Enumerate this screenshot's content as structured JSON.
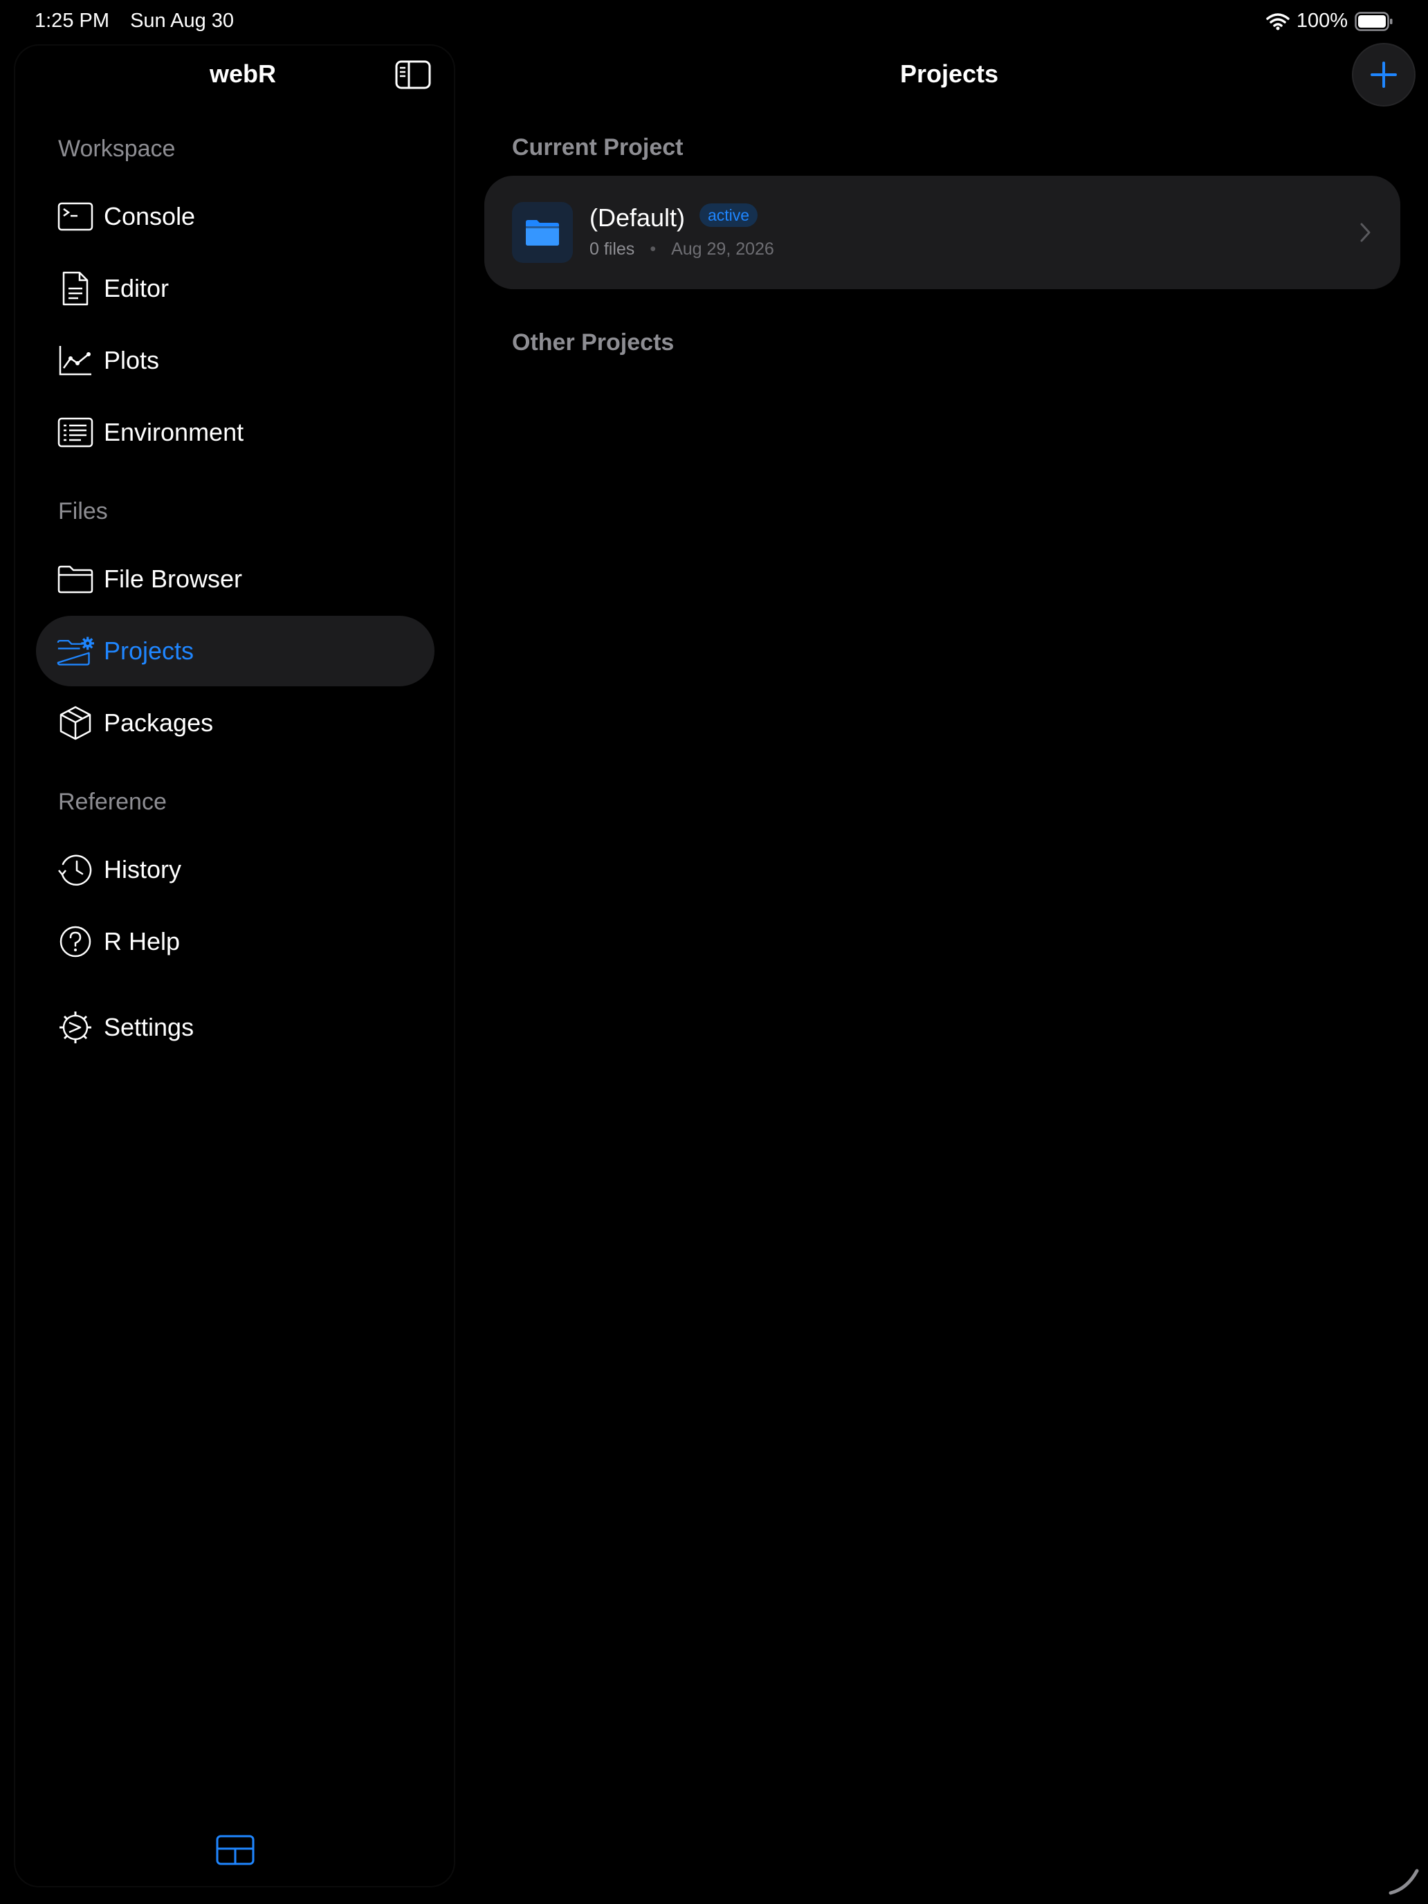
{
  "status": {
    "time": "1:25 PM",
    "date": "Sun Aug 30",
    "battery": "100%"
  },
  "sidebar": {
    "title": "webR",
    "sections": [
      {
        "label": "Workspace",
        "items": [
          {
            "label": "Console",
            "icon": "terminal-icon"
          },
          {
            "label": "Editor",
            "icon": "document-icon"
          },
          {
            "label": "Plots",
            "icon": "line-chart-icon"
          },
          {
            "label": "Environment",
            "icon": "list-icon"
          }
        ]
      },
      {
        "label": "Files",
        "items": [
          {
            "label": "File Browser",
            "icon": "folder-icon"
          },
          {
            "label": "Projects",
            "icon": "folder-gear-icon",
            "active": true
          },
          {
            "label": "Packages",
            "icon": "box-icon"
          }
        ]
      },
      {
        "label": "Reference",
        "items": [
          {
            "label": "History",
            "icon": "history-icon"
          },
          {
            "label": "R Help",
            "icon": "question-icon"
          }
        ]
      }
    ],
    "settings_label": "Settings"
  },
  "main": {
    "title": "Projects",
    "current_project_label": "Current Project",
    "other_projects_label": "Other Projects",
    "current_project": {
      "name": "(Default)",
      "badge": "active",
      "files": "0 files",
      "separator": "•",
      "date": "Aug 29, 2026"
    }
  },
  "colors": {
    "accent": "#1f86ff",
    "background": "#000000",
    "card": "#1c1c1e",
    "secondary_text": "#8e8e93"
  }
}
